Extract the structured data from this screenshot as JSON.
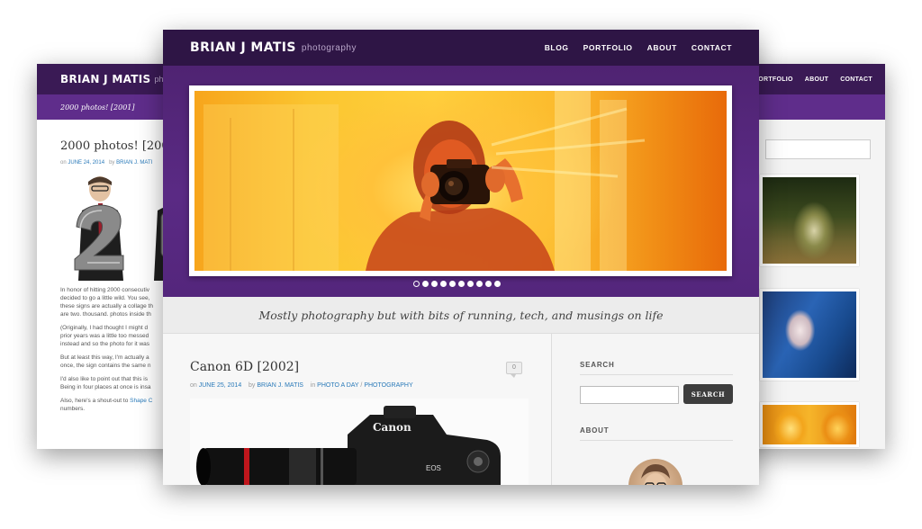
{
  "colors": {
    "topbar": "#2e1545",
    "hero_purple": "#5a2a84",
    "link": "#2a7ab9",
    "button_dark": "#3d3d3d"
  },
  "back_left": {
    "brand": "BRIAN J MATIS",
    "brand_sub": "photograp",
    "breadcrumb": "2000 photos! [2001]",
    "post_title": "2000 photos! [2001]",
    "meta_on": "on",
    "meta_date": "JUNE 24, 2014",
    "meta_by": "by",
    "meta_author": "BRIAN J. MATI",
    "paragraphs": [
      "In honor of hitting 2000 consecutiv",
      "decided to go a little wild. You see,",
      "these signs are actually a collage th",
      "are two. thousand. photos inside th",
      "(Originally, I had thought I might d",
      "prior years was a little too messed",
      "instead and so the photo for it was",
      "But at least this way, I'm actually a",
      "once, the sign contains the same n",
      "I'd also like to point out that this is",
      "Being in four places at once is insa",
      "Also, here's a shout-out to",
      "numbers."
    ],
    "shoutout_link": "Shape C"
  },
  "back_right": {
    "nav": [
      "PORTFOLIO",
      "ABOUT",
      "CONTACT"
    ]
  },
  "front": {
    "brand": "BRIAN J MATIS",
    "brand_sub": "photography",
    "nav": [
      "BLOG",
      "PORTFOLIO",
      "ABOUT",
      "CONTACT"
    ],
    "slider_total": 10,
    "slider_active": 1,
    "tagline": "Mostly photography but with bits of running, tech, and musings on life",
    "post": {
      "title": "Canon 6D [2002]",
      "comments": "0",
      "on": "on",
      "date": "JUNE 25, 2014",
      "by": "by",
      "author": "BRIAN J. MATIS",
      "in": "in",
      "cat1": "PHOTO A DAY",
      "sep": "/",
      "cat2": "PHOTOGRAPHY",
      "camera_brand": "Canon",
      "camera_model": "EOS"
    },
    "sidebar": {
      "search_heading": "SEARCH",
      "search_button": "SEARCH",
      "about_heading": "ABOUT"
    }
  }
}
